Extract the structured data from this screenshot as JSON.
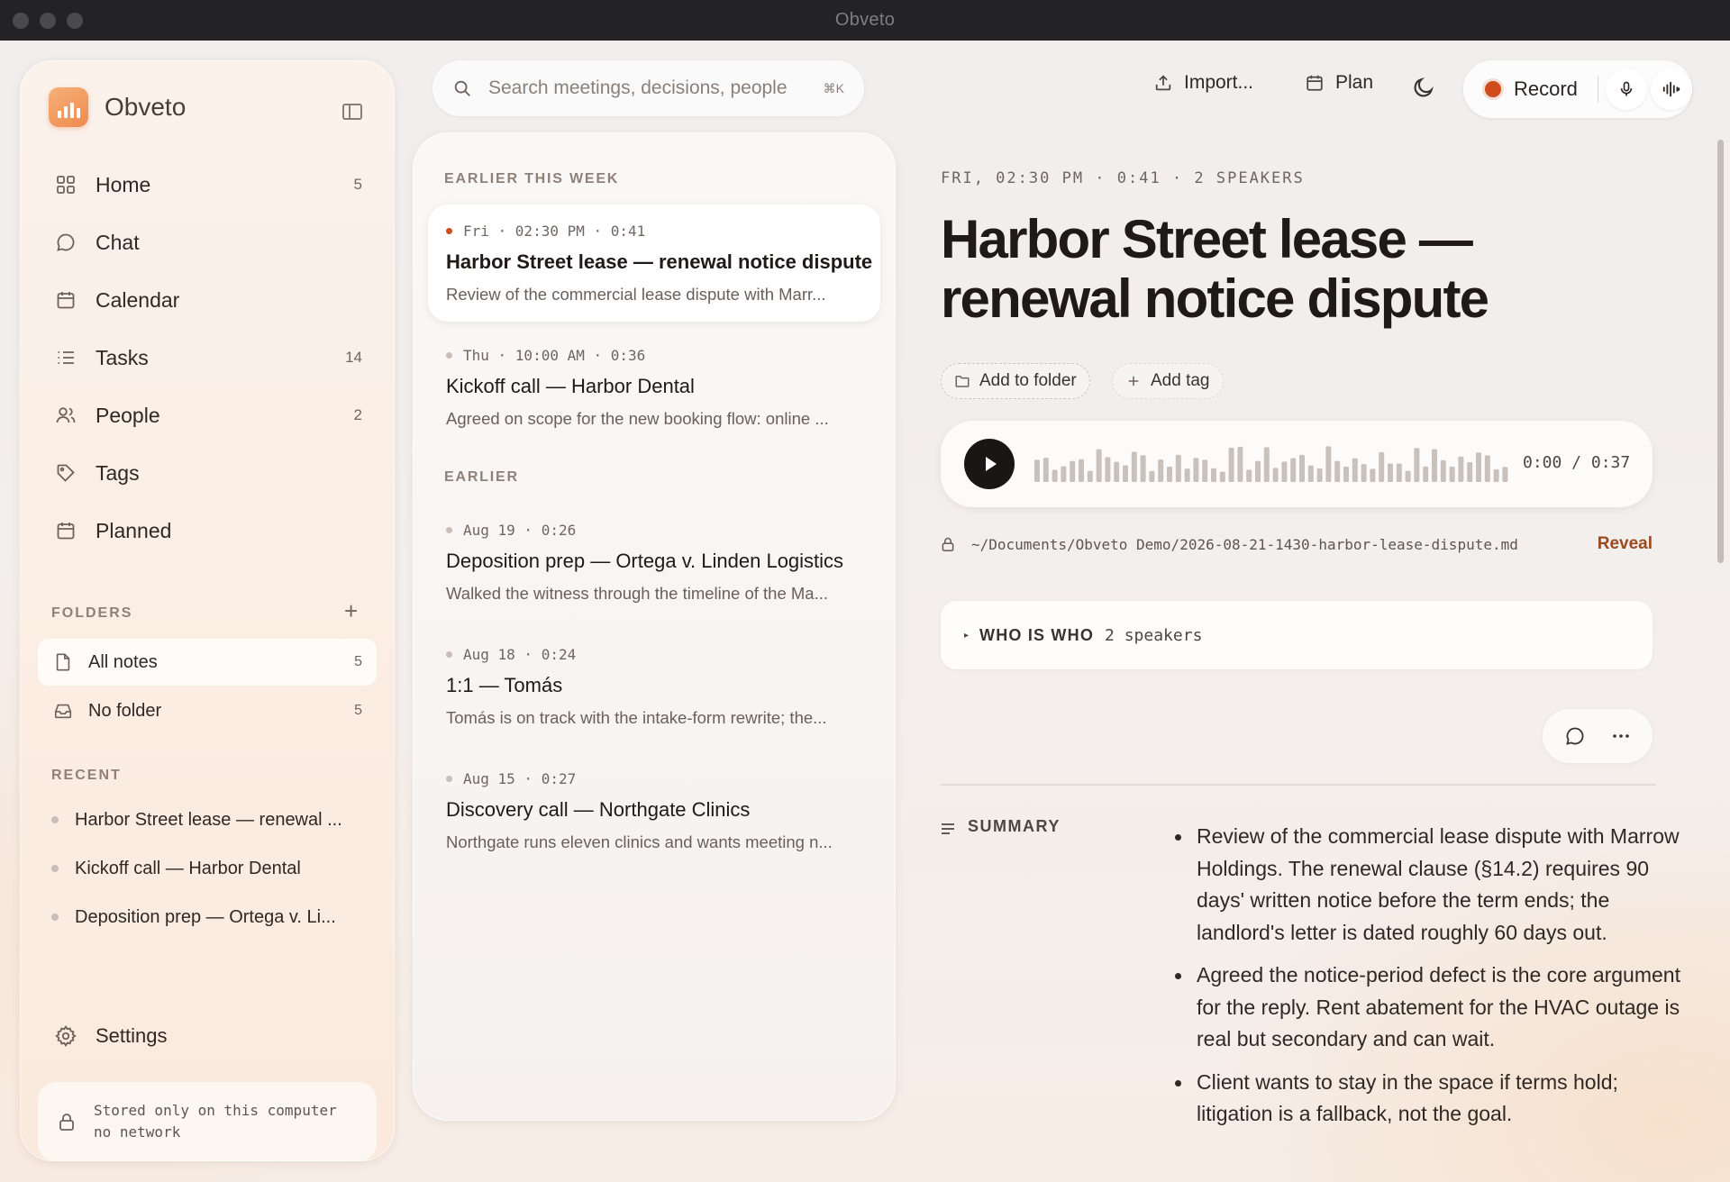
{
  "window": {
    "title": "Obveto"
  },
  "sidebar": {
    "brand": "Obveto",
    "nav": [
      {
        "label": "Home",
        "count": "5",
        "icon": "grid-icon"
      },
      {
        "label": "Chat",
        "count": "",
        "icon": "chat-icon"
      },
      {
        "label": "Calendar",
        "count": "",
        "icon": "calendar-icon"
      },
      {
        "label": "Tasks",
        "count": "14",
        "icon": "list-icon"
      },
      {
        "label": "People",
        "count": "2",
        "icon": "people-icon"
      },
      {
        "label": "Tags",
        "count": "",
        "icon": "tag-icon"
      },
      {
        "label": "Planned",
        "count": "",
        "icon": "calendar-icon"
      }
    ],
    "folders_heading": "FOLDERS",
    "folders": [
      {
        "label": "All notes",
        "count": "5",
        "icon": "document-icon"
      },
      {
        "label": "No folder",
        "count": "5",
        "icon": "inbox-icon"
      }
    ],
    "recent_heading": "RECENT",
    "recent": [
      {
        "label": "Harbor Street lease — renewal ..."
      },
      {
        "label": "Kickoff call — Harbor Dental"
      },
      {
        "label": "Deposition prep — Ortega v. Li..."
      }
    ],
    "settings_label": "Settings",
    "privacy_line1": "Stored only on this computer",
    "privacy_line2": "no network"
  },
  "search": {
    "placeholder": "Search meetings, decisions, people",
    "shortcut": "⌘K"
  },
  "toolbar": {
    "import_label": "Import...",
    "plan_label": "Plan",
    "record_label": "Record",
    "record_color": "#cf4c1c"
  },
  "notes": {
    "section_recent": "EARLIER THIS WEEK",
    "section_earlier": "EARLIER",
    "items": [
      {
        "meta": "Fri · 02:30 PM · 0:41",
        "title": "Harbor Street lease — renewal notice dispute",
        "snippet": "Review of the commercial lease dispute with Marr..."
      },
      {
        "meta": "Thu · 10:00 AM · 0:36",
        "title": "Kickoff call — Harbor Dental",
        "snippet": "Agreed on scope for the new booking flow: online ..."
      },
      {
        "meta": "Aug 19 · 0:26",
        "title": "Deposition prep — Ortega v. Linden Logistics",
        "snippet": "Walked the witness through the timeline of the Ma..."
      },
      {
        "meta": "Aug 18 · 0:24",
        "title": "1:1 — Tomás",
        "snippet": "Tomás is on track with the intake-form rewrite; the..."
      },
      {
        "meta": "Aug 15 · 0:27",
        "title": "Discovery call — Northgate Clinics",
        "snippet": "Northgate runs eleven clinics and wants meeting n..."
      }
    ]
  },
  "detail": {
    "meta": "FRI, 02:30 PM · 0:41 · 2 SPEAKERS",
    "title": "Harbor Street lease — renewal notice dispute",
    "add_folder_label": "Add to folder",
    "add_tag_label": "Add tag",
    "player_time": "0:00 / 0:37",
    "file_path": "~/Documents/Obveto Demo/2026-08-21-1430-harbor-lease-dispute.md",
    "reveal_label": "Reveal",
    "who_label": "WHO IS WHO",
    "who_count": "2 speakers",
    "summary_heading": "SUMMARY",
    "summary": [
      "Review of the commercial lease dispute with Marrow Holdings. The renewal clause (§14.2) requires 90 days' written notice before the term ends; the landlord's letter is dated roughly 60 days out.",
      "Agreed the notice-period defect is the core argument for the reply. Rent abatement for the HVAC outage is real but secondary and can wait.",
      "Client wants to stay in the space if terms hold; litigation is a fallback, not the goal."
    ]
  }
}
